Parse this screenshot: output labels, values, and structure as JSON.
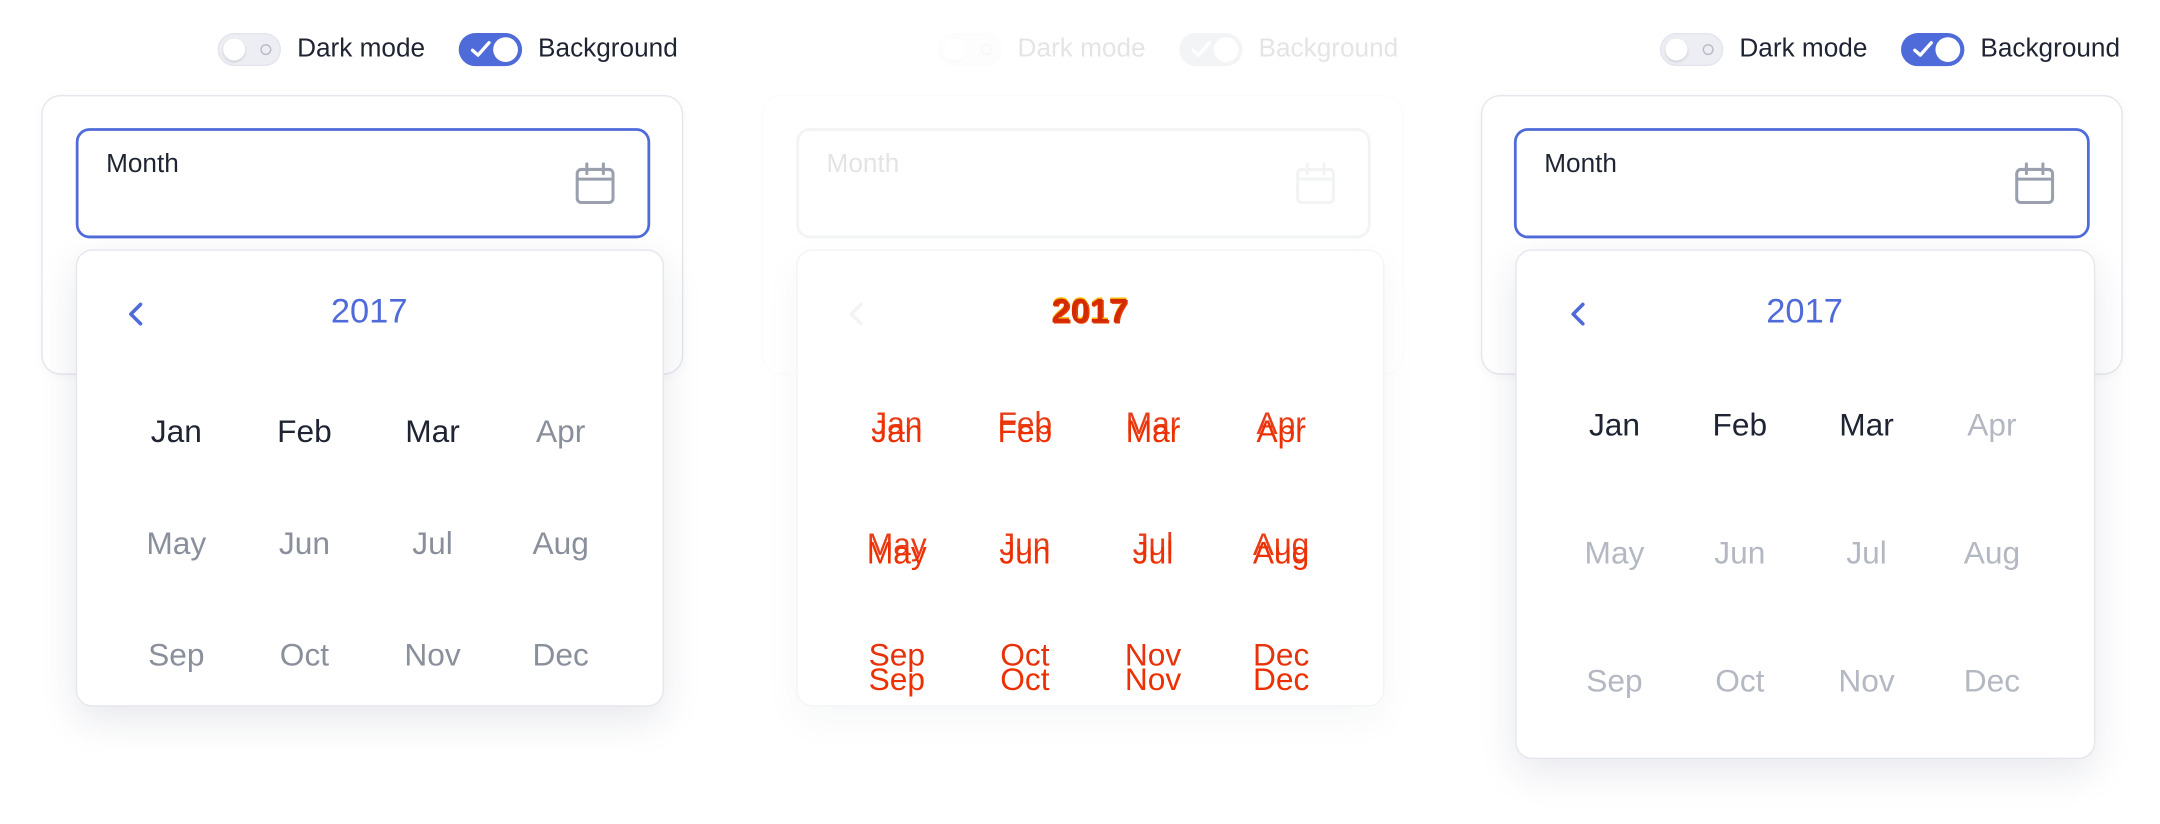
{
  "panels": [
    {
      "toggles": [
        {
          "label": "Dark mode",
          "on": false
        },
        {
          "label": "Background",
          "on": true
        }
      ],
      "field": {
        "label": "Month"
      },
      "picker": {
        "year": "2017",
        "months": [
          "Jan",
          "Feb",
          "Mar",
          "Apr",
          "May",
          "Jun",
          "Jul",
          "Aug",
          "Sep",
          "Oct",
          "Nov",
          "Dec"
        ]
      }
    },
    {
      "toggles": [
        {
          "label": "Dark mode",
          "on": false
        },
        {
          "label": "Background",
          "on": true
        }
      ],
      "field": {
        "label": "Month"
      },
      "picker": {
        "year": "2017",
        "months": [
          "Jan",
          "Feb",
          "Mar",
          "Apr",
          "May",
          "Jun",
          "Jul",
          "Aug",
          "Sep",
          "Oct",
          "Nov",
          "Dec"
        ]
      }
    },
    {
      "toggles": [
        {
          "label": "Dark mode",
          "on": false
        },
        {
          "label": "Background",
          "on": true
        }
      ],
      "field": {
        "label": "Month"
      },
      "picker": {
        "year": "2017",
        "months": [
          "Jan",
          "Feb",
          "Mar",
          "Apr",
          "May",
          "Jun",
          "Jul",
          "Aug",
          "Sep",
          "Oct",
          "Nov",
          "Dec"
        ]
      }
    }
  ],
  "colors": {
    "accent": "#4f6bd9",
    "glitch": "#ee3000"
  }
}
